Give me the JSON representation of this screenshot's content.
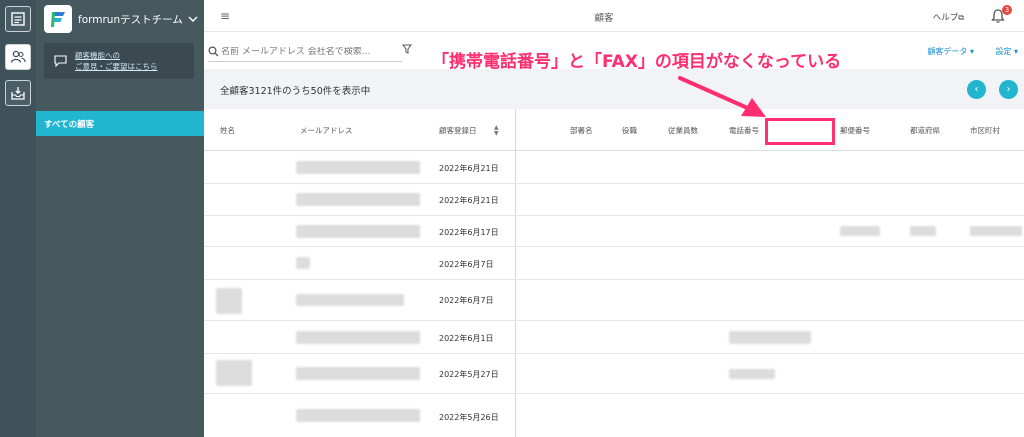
{
  "sidebar": {
    "team_name": "formrunテストチーム",
    "feedback_line1": "顧客機能への",
    "feedback_line2": "ご意見・ご要望はこちら",
    "active_item": "すべての顧客"
  },
  "topbar": {
    "title": "顧客",
    "help": "ヘルプ",
    "notification_count": "3"
  },
  "search": {
    "placeholder": "名前 メールアドレス 会社名で検索..."
  },
  "toolbar": {
    "customer_data": "顧客データ ▾",
    "settings": "設定 ▾"
  },
  "count_text": "全顧客3121件のうち50件を表示中",
  "table": {
    "headers": {
      "name": "姓名",
      "email": "メールアドレス",
      "registered": "顧客登録日",
      "department": "部署名",
      "position": "役職",
      "employees": "従業員数",
      "phone": "電話番号",
      "postal": "郵便番号",
      "prefecture": "都道府県",
      "city": "市区町村"
    },
    "rows": [
      {
        "date": "2022年6月21日"
      },
      {
        "date": "2022年6月21日"
      },
      {
        "date": "2022年6月17日"
      },
      {
        "date": "2022年6月7日"
      },
      {
        "date": "2022年6月7日"
      },
      {
        "date": "2022年6月1日"
      },
      {
        "date": "2022年5月27日"
      },
      {
        "date": "2022年5月26日"
      }
    ]
  },
  "annotation": {
    "text": "「携帯電話番号」と「FAX」の項目がなくなっている"
  },
  "colors": {
    "accent": "#22b5cf",
    "annotation": "#ff2e70",
    "sidebar": "#46595f"
  }
}
